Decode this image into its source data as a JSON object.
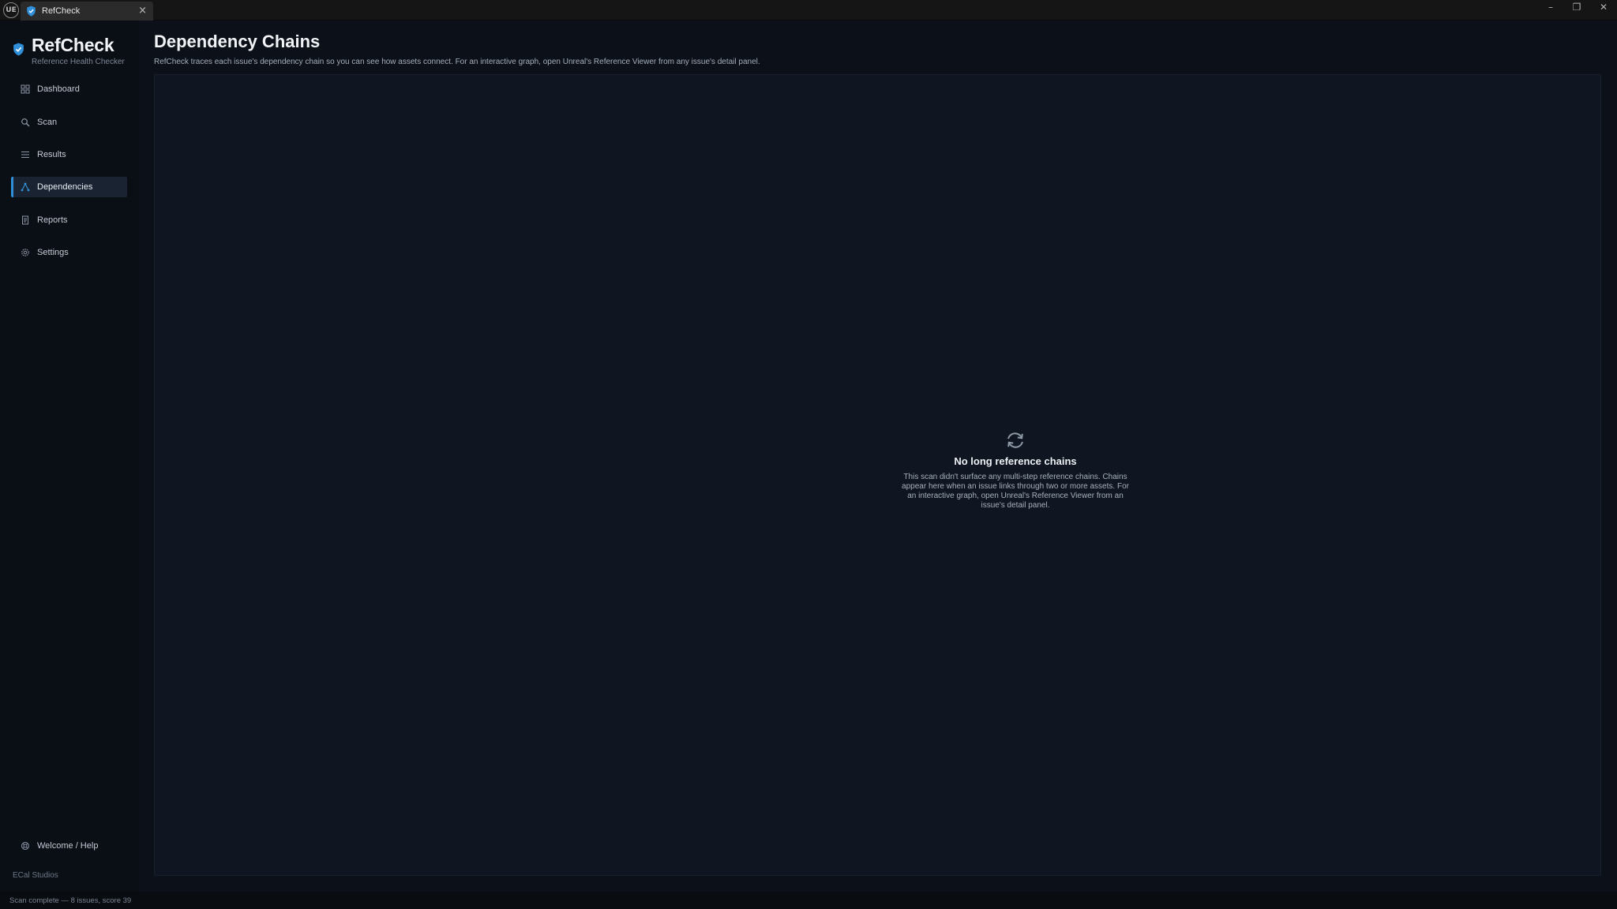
{
  "window": {
    "tab_title": "RefCheck",
    "tab_close": "×",
    "engine_logo": "UE",
    "controls": {
      "minimize": "–",
      "maximize": "❐",
      "close": "✕"
    }
  },
  "brand": {
    "title": "RefCheck",
    "subtitle": "Reference Health Checker",
    "icon": "shield-check-icon",
    "accent": "#2f8fd8"
  },
  "sidebar": {
    "items": [
      {
        "label": "Dashboard",
        "icon": "grid-icon"
      },
      {
        "label": "Scan",
        "icon": "search-icon"
      },
      {
        "label": "Results",
        "icon": "list-icon"
      },
      {
        "label": "Dependencies",
        "icon": "dependency-tree-icon",
        "active": true
      },
      {
        "label": "Reports",
        "icon": "document-icon"
      },
      {
        "label": "Settings",
        "icon": "gear-icon"
      }
    ],
    "help": {
      "label": "Welcome / Help",
      "icon": "lifebuoy-icon"
    },
    "studio": "ECal Studios"
  },
  "main": {
    "title": "Dependency Chains",
    "description": "RefCheck traces each issue's dependency chain so you can see how assets connect. For an interactive graph, open Unreal's Reference Viewer from any issue's detail panel.",
    "empty_state": {
      "icon": "refresh-arrows-icon",
      "title": "No long reference chains",
      "body": "This scan didn't surface any multi-step reference chains. Chains appear here when an issue links through two or more assets. For an interactive graph, open Unreal's Reference Viewer from an issue's detail panel."
    }
  },
  "status": {
    "text": "Scan complete — 8 issues, score 39"
  }
}
